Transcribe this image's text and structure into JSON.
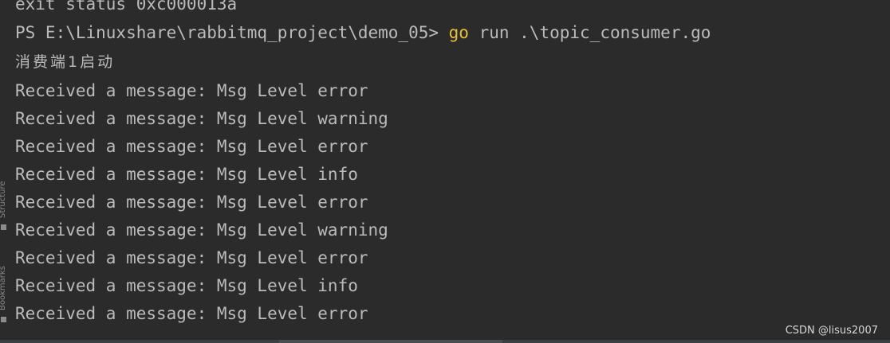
{
  "terminal": {
    "lines": [
      {
        "kind": "text",
        "text": "exit status 0xc000013a"
      },
      {
        "kind": "prompt",
        "prompt": "PS E:\\Linuxshare\\rabbitmq_project\\demo_05> ",
        "command": "go",
        "args": " run .\\topic_consumer.go"
      },
      {
        "kind": "cjk",
        "text": "消费端1启动"
      },
      {
        "kind": "text",
        "text": "Received a message: Msg Level error"
      },
      {
        "kind": "text",
        "text": "Received a message: Msg Level warning"
      },
      {
        "kind": "text",
        "text": "Received a message: Msg Level error"
      },
      {
        "kind": "text",
        "text": "Received a message: Msg Level info"
      },
      {
        "kind": "text",
        "text": "Received a message: Msg Level error"
      },
      {
        "kind": "text",
        "text": "Received a message: Msg Level warning"
      },
      {
        "kind": "text",
        "text": "Received a message: Msg Level error"
      },
      {
        "kind": "text",
        "text": "Received a message: Msg Level info"
      },
      {
        "kind": "text",
        "text": "Received a message: Msg Level error"
      }
    ]
  },
  "side_panel": {
    "structure_label": "Structure",
    "bookmarks_label": "Bookmarks"
  },
  "watermark": "CSDN @lisus2007",
  "colors": {
    "background": "#2b2b2b",
    "text": "#bbbbbb",
    "command": "#e8bf3c"
  }
}
